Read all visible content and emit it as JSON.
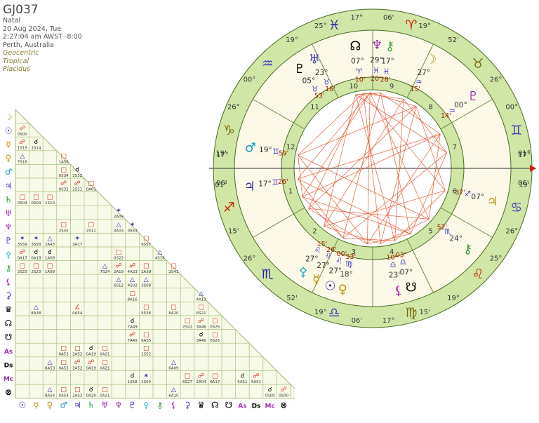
{
  "chart": {
    "title": "GJ037",
    "info": [
      "Natal",
      "20 Aug 2024, Tue",
      "2:27:04 am AWST -8:00",
      "Perth, Australia"
    ],
    "info_em": [
      "Geocentric",
      "Tropical",
      "Placidus"
    ]
  },
  "colors": {
    "wheel_ring": "#cfe6a6",
    "house_bg": "#fdf9e8",
    "grid_bg": "#f7fae8",
    "grid_line": "#a8bf78",
    "aspect_red": "#e4582e",
    "aspect_blue": "#3c3cd0"
  },
  "zodiac": [
    {
      "glyph": "♈",
      "color": "#cc2200"
    },
    {
      "glyph": "♉",
      "color": "#7a6a10"
    },
    {
      "glyph": "♊",
      "color": "#3d3dbf"
    },
    {
      "glyph": "♋",
      "color": "#3d3dbf"
    },
    {
      "glyph": "♌",
      "color": "#cc2200"
    },
    {
      "glyph": "♍",
      "color": "#7a6a10"
    },
    {
      "glyph": "♎",
      "color": "#3d3dbf"
    },
    {
      "glyph": "♏",
      "color": "#2020a0"
    },
    {
      "glyph": "♐",
      "color": "#cc2200"
    },
    {
      "glyph": "♑",
      "color": "#7a6a10"
    },
    {
      "glyph": "♒",
      "color": "#3d3dbf"
    },
    {
      "glyph": "♓",
      "color": "#2020a0"
    }
  ],
  "cusp_labels": [
    {
      "deg": "01°",
      "min": "19'"
    },
    {
      "deg": "26°",
      "min": "15'"
    },
    {
      "deg": "19°",
      "min": "52'"
    },
    {
      "deg": "17°",
      "min": "06'"
    },
    {
      "deg": "19°",
      "min": "15'"
    },
    {
      "deg": "26°",
      "min": "25°"
    },
    {
      "deg": "01°",
      "min": "19'"
    },
    {
      "deg": "26°",
      "min": "00°"
    },
    {
      "deg": "19°",
      "min": "52'"
    },
    {
      "deg": "17°",
      "min": "06'"
    },
    {
      "deg": "19°",
      "min": "25°"
    },
    {
      "deg": "26°",
      "min": "00°"
    }
  ],
  "house_numbers": [
    "1",
    "2",
    "3",
    "4",
    "5",
    "6",
    "7",
    "8",
    "9",
    "10",
    "11",
    "12"
  ],
  "angle_labels": {
    "asc_deg": "17°",
    "asc_min": "06'",
    "dsc_deg": "17°",
    "dsc_min": "06'"
  },
  "planets": [
    {
      "glyph": "♃",
      "color": "#3030b0",
      "deg": "17°",
      "sign": "♊",
      "min": "26'"
    },
    {
      "glyph": "♂",
      "color": "#1098c8",
      "deg": "19°",
      "sign": "♊",
      "min": "59'"
    },
    {
      "glyph": "♅",
      "color": "#3030b0",
      "deg": "23°",
      "sign": "♉",
      "min": "16'"
    },
    {
      "glyph": "♇",
      "color": "#000000",
      "deg": "05°",
      "sign": "♉",
      "min": "53'"
    },
    {
      "glyph": "☊",
      "color": "#000000",
      "deg": "07°",
      "sign": "♈",
      "min": "10'"
    },
    {
      "glyph": "♆",
      "color": "#9a30b0",
      "deg": "29°",
      "sign": "♓",
      "min": "20'"
    },
    {
      "glyph": "⚷",
      "color": "#30a030",
      "deg": "17°",
      "sign": "♓",
      "min": "28'"
    },
    {
      "glyph": "☽",
      "color": "#b0a020",
      "deg": "27°",
      "sign": "♒",
      "min": "15'"
    },
    {
      "glyph": "♇",
      "color": "#9a30b0",
      "deg": "00°",
      "sign": "♒",
      "min": "14'"
    },
    {
      "glyph": "♀",
      "color": "#c09000",
      "deg": "18°",
      "sign": "♍",
      "min": "33'"
    },
    {
      "glyph": "☉",
      "color": "#2a2ab0",
      "deg": "27°",
      "sign": "♌",
      "min": "00'"
    },
    {
      "glyph": "☿",
      "color": "#c09000",
      "deg": "27°",
      "sign": "♌",
      "min": "26'"
    },
    {
      "glyph": "⚴",
      "color": "#30b0c0",
      "deg": "27°",
      "sign": "♌",
      "min": "15'"
    },
    {
      "glyph": "☋",
      "color": "#000000",
      "deg": "07°",
      "sign": "♎",
      "min": "03'"
    },
    {
      "glyph": "⚸",
      "color": "#c020c0",
      "deg": "23°",
      "sign": "♎",
      "min": "10'"
    },
    {
      "glyph": "⚷",
      "color": "#30a030",
      "deg": "24°",
      "sign": "♏",
      "min": "52'"
    },
    {
      "glyph": "♃",
      "color": "#b0a020",
      "deg": "07°",
      "sign": "♐",
      "min": "37'"
    }
  ],
  "grid_glyphs": [
    {
      "glyph": "☽",
      "color": "#b0a020"
    },
    {
      "glyph": "☉",
      "color": "#2a2ab0"
    },
    {
      "glyph": "☿",
      "color": "#c09000"
    },
    {
      "glyph": "♀",
      "color": "#c09000"
    },
    {
      "glyph": "♂",
      "color": "#1098c8"
    },
    {
      "glyph": "♃",
      "color": "#3030b0"
    },
    {
      "glyph": "♄",
      "color": "#30a030"
    },
    {
      "glyph": "♅",
      "color": "#9a30b0"
    },
    {
      "glyph": "♆",
      "color": "#9a30b0"
    },
    {
      "glyph": "♇",
      "color": "#3030b0"
    },
    {
      "glyph": "⚴",
      "color": "#30b0c0"
    },
    {
      "glyph": "⚷",
      "color": "#30a030"
    },
    {
      "glyph": "⚸",
      "color": "#c020c0"
    },
    {
      "glyph": "⚳",
      "color": "#3030b0"
    },
    {
      "glyph": "♛",
      "color": "#000000"
    },
    {
      "glyph": "☊",
      "color": "#000000"
    },
    {
      "glyph": "☋",
      "color": "#000000"
    },
    {
      "glyph": "As",
      "color": "#9a30b0"
    },
    {
      "glyph": "Ds",
      "color": "#000000"
    },
    {
      "glyph": "Mc",
      "color": "#9a30b0"
    },
    {
      "glyph": "⊗",
      "color": "#000000"
    }
  ],
  "grid_cells": [
    {
      "r": 1,
      "c": 0,
      "s": "☍",
      "t": "0S00"
    },
    {
      "r": 2,
      "c": 0,
      "s": "☍",
      "t": "1S15"
    },
    {
      "r": 2,
      "c": 1,
      "s": "☌",
      "t": "1S14"
    },
    {
      "r": 3,
      "c": 0,
      "s": "△",
      "t": "7S16"
    },
    {
      "r": 3,
      "c": 3,
      "s": "□",
      "t": "1A58"
    },
    {
      "r": 4,
      "c": 3,
      "s": "□",
      "t": "0S34"
    },
    {
      "r": 4,
      "c": 4,
      "s": "☌",
      "t": "2S32"
    },
    {
      "r": 5,
      "c": 3,
      "s": "☍",
      "t": "0S32"
    },
    {
      "r": 5,
      "c": 4,
      "s": "☍",
      "t": "2S31"
    },
    {
      "r": 5,
      "c": 5,
      "s": "□",
      "t": "0A01"
    },
    {
      "r": 6,
      "c": 0,
      "s": "□",
      "t": "0S04"
    },
    {
      "r": 6,
      "c": 1,
      "s": "□",
      "t": "0S04"
    },
    {
      "r": 6,
      "c": 2,
      "s": "□",
      "t": "1S10"
    },
    {
      "r": 7,
      "c": 7,
      "s": "✶",
      "t": "2A09"
    },
    {
      "r": 8,
      "c": 3,
      "s": "□",
      "t": "2S45"
    },
    {
      "r": 8,
      "c": 5,
      "s": "□",
      "t": "2S11"
    },
    {
      "r": 8,
      "c": 7,
      "s": "△",
      "t": "3A03"
    },
    {
      "r": 8,
      "c": 8,
      "s": "✶",
      "t": "0S53"
    },
    {
      "r": 9,
      "c": 0,
      "s": "✶",
      "t": "3S59"
    },
    {
      "r": 9,
      "c": 1,
      "s": "✶",
      "t": "3S58"
    },
    {
      "r": 9,
      "c": 2,
      "s": "△",
      "t": "2A43"
    },
    {
      "r": 9,
      "c": 4,
      "s": "✶",
      "t": "3A17"
    },
    {
      "r": 9,
      "c": 9,
      "s": "□",
      "t": "6S57"
    },
    {
      "r": 10,
      "c": 0,
      "s": "☍",
      "t": "0A17"
    },
    {
      "r": 10,
      "c": 1,
      "s": "☌",
      "t": "0A18"
    },
    {
      "r": 10,
      "c": 2,
      "s": "☌",
      "t": "1A08"
    },
    {
      "r": 10,
      "c": 7,
      "s": "□",
      "t": "0S22"
    },
    {
      "r": 10,
      "c": 10,
      "s": "△",
      "t": "4S16"
    },
    {
      "r": 11,
      "c": 0,
      "s": "□",
      "t": "2S23"
    },
    {
      "r": 11,
      "c": 1,
      "s": "□",
      "t": "2S23"
    },
    {
      "r": 11,
      "c": 2,
      "s": "□",
      "t": "1A08"
    },
    {
      "r": 11,
      "c": 6,
      "s": "△",
      "t": "7S24"
    },
    {
      "r": 11,
      "c": 7,
      "s": "☍",
      "t": "2A19"
    },
    {
      "r": 11,
      "c": 8,
      "s": "☍",
      "t": "4A23"
    },
    {
      "r": 11,
      "c": 9,
      "s": "□",
      "t": "2A39"
    },
    {
      "r": 11,
      "c": 11,
      "s": "□",
      "t": "2S41"
    },
    {
      "r": 12,
      "c": 7,
      "s": "△",
      "t": "6S12"
    },
    {
      "r": 12,
      "c": 8,
      "s": "△",
      "t": "4S02"
    },
    {
      "r": 12,
      "c": 9,
      "s": "△",
      "t": "3S08"
    },
    {
      "r": 13,
      "c": 8,
      "s": "□",
      "t": "8A16"
    },
    {
      "r": 13,
      "c": 13,
      "s": "△",
      "t": "4A13"
    },
    {
      "r": 14,
      "c": 1,
      "s": "△",
      "t": "8A38"
    },
    {
      "r": 14,
      "c": 4,
      "s": "∠",
      "t": "0A54"
    },
    {
      "r": 14,
      "c": 9,
      "s": "□",
      "t": "5S38"
    },
    {
      "r": 14,
      "c": 11,
      "s": "□",
      "t": "8A20"
    },
    {
      "r": 14,
      "c": 13,
      "s": "□",
      "t": "6S21"
    },
    {
      "r": 15,
      "c": 8,
      "s": "☌",
      "t": "7A49"
    },
    {
      "r": 15,
      "c": 12,
      "s": "□",
      "t": "2S41"
    },
    {
      "r": 15,
      "c": 13,
      "s": "☍",
      "t": "3A46"
    },
    {
      "r": 15,
      "c": 14,
      "s": "□",
      "t": "0S26"
    },
    {
      "r": 16,
      "c": 8,
      "s": "☍",
      "t": "7A49"
    },
    {
      "r": 16,
      "c": 9,
      "s": "□",
      "t": "6A55"
    },
    {
      "r": 16,
      "c": 13,
      "s": "☌",
      "t": "3A46"
    },
    {
      "r": 16,
      "c": 14,
      "s": "□",
      "t": "0S26"
    },
    {
      "r": 17,
      "c": 3,
      "s": "□",
      "t": "0A53"
    },
    {
      "r": 17,
      "c": 4,
      "s": "□",
      "t": "2A52"
    },
    {
      "r": 17,
      "c": 5,
      "s": "☌",
      "t": "0A19"
    },
    {
      "r": 17,
      "c": 6,
      "s": "□",
      "t": "0A21"
    },
    {
      "r": 17,
      "c": 9,
      "s": "□",
      "t": "1S52"
    },
    {
      "r": 18,
      "c": 2,
      "s": "△",
      "t": "8A53"
    },
    {
      "r": 18,
      "c": 3,
      "s": "□",
      "t": "0A53"
    },
    {
      "r": 18,
      "c": 4,
      "s": "☍",
      "t": "2A52"
    },
    {
      "r": 18,
      "c": 5,
      "s": "☍",
      "t": "0A19"
    },
    {
      "r": 18,
      "c": 6,
      "s": "□",
      "t": "0A21"
    },
    {
      "r": 18,
      "c": 11,
      "s": "△",
      "t": "6A09"
    },
    {
      "r": 19,
      "c": 8,
      "s": "☌",
      "t": "1S58"
    },
    {
      "r": 19,
      "c": 9,
      "s": "✶",
      "t": "1S04"
    },
    {
      "r": 19,
      "c": 12,
      "s": "□",
      "t": "6S27"
    },
    {
      "r": 19,
      "c": 13,
      "s": "☍",
      "t": "2A04"
    },
    {
      "r": 19,
      "c": 14,
      "s": "□",
      "t": "6A17"
    },
    {
      "r": 19,
      "c": 16,
      "s": "☌",
      "t": "5A51"
    },
    {
      "r": 19,
      "c": 17,
      "s": "☍",
      "t": "5A51"
    },
    {
      "r": 20,
      "c": 2,
      "s": "△",
      "t": "8A54"
    },
    {
      "r": 20,
      "c": 3,
      "s": "□",
      "t": "0A54"
    },
    {
      "r": 20,
      "c": 4,
      "s": "□",
      "t": "2A52"
    },
    {
      "r": 20,
      "c": 5,
      "s": "☌",
      "t": "0A20"
    },
    {
      "r": 20,
      "c": 6,
      "s": "□",
      "t": "0A21"
    },
    {
      "r": 20,
      "c": 11,
      "s": "△",
      "t": "6A10"
    },
    {
      "r": 20,
      "c": 18,
      "s": "☌",
      "t": "0S00"
    },
    {
      "r": 20,
      "c": 19,
      "s": "☍",
      "t": "0S00"
    }
  ]
}
